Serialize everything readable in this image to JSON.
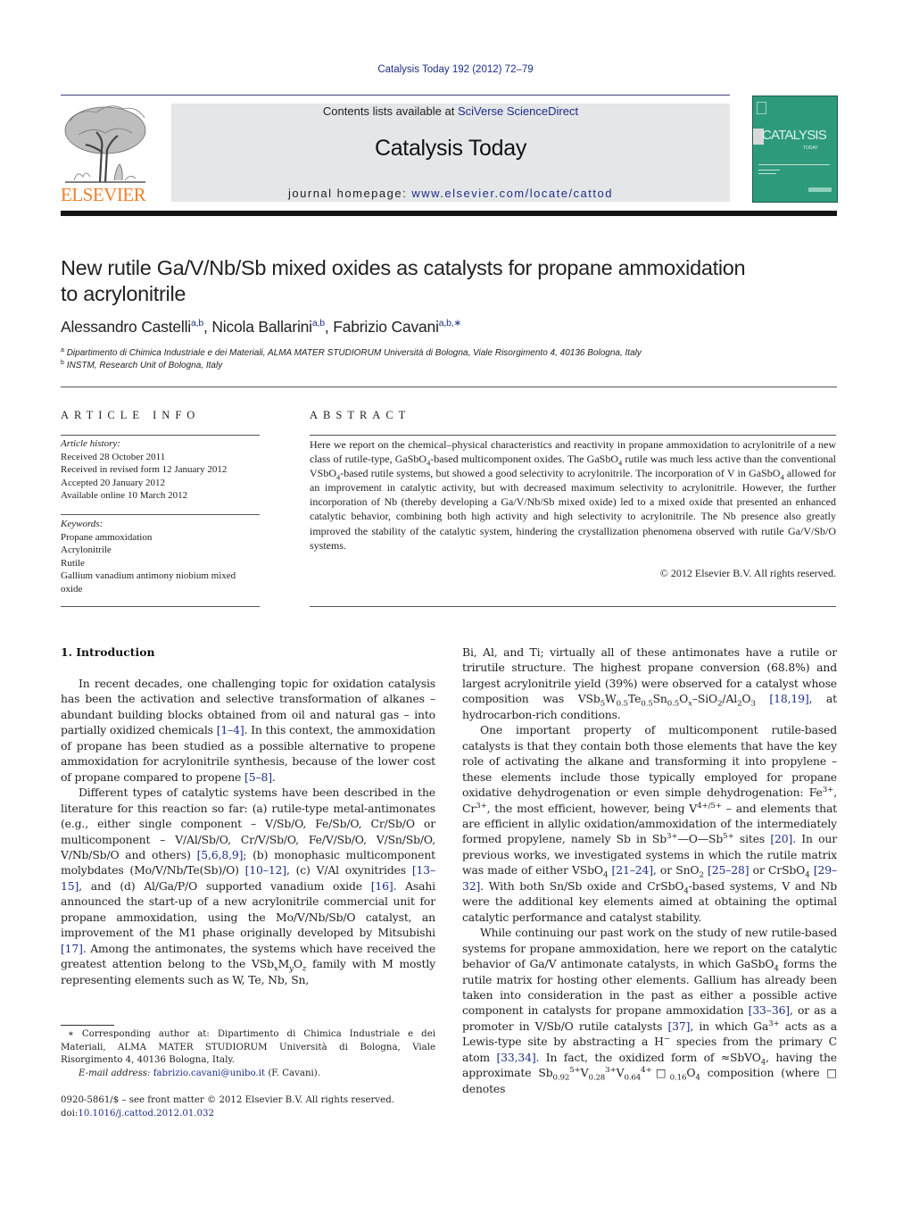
{
  "header": {
    "citation": "Catalysis Today 192 (2012) 72–79",
    "contents_prefix": "Contents lists available at ",
    "contents_link": "SciVerse ScienceDirect",
    "journal_title": "Catalysis Today",
    "homepage_prefix": "journal homepage: ",
    "homepage_link": "www.elsevier.com/locate/cattod",
    "publisher_logo_text": "ELSEVIER",
    "cover_title": "CATALYSIS",
    "cover_subtitle": "TODAY",
    "colors": {
      "link": "#1d2f87",
      "elsevier_orange": "#f07f2a",
      "cover_green": "#2e9a7c",
      "band_gray": "#e5e6e8"
    }
  },
  "article": {
    "title_line1": "New rutile Ga/V/Nb/Sb mixed oxides as catalysts for propane ammoxidation",
    "title_line2": "to acrylonitrile",
    "authors": [
      {
        "name": "Alessandro Castelli",
        "sup": "a,b"
      },
      {
        "name": "Nicola Ballarini",
        "sup": "a,b"
      },
      {
        "name": "Fabrizio Cavani",
        "sup": "a,b,∗"
      }
    ],
    "author_separator": ", ",
    "affiliations": [
      {
        "mark": "a",
        "text": "Dipartimento di Chimica Industriale e dei Materiali, ALMA MATER STUDIORUM Università di Bologna, Viale Risorgimento 4, 40136 Bologna, Italy"
      },
      {
        "mark": "b",
        "text": "INSTM, Research Unit of Bologna, Italy"
      }
    ]
  },
  "article_info": {
    "heading": "ARTICLE INFO",
    "history_label": "Article history:",
    "history": [
      "Received 28 October 2011",
      "Received in revised form 12 January 2012",
      "Accepted 20 January 2012",
      "Available online 10 March 2012"
    ],
    "keywords_label": "Keywords:",
    "keywords": [
      "Propane ammoxidation",
      "Acrylonitrile",
      "Rutile",
      "Gallium vanadium antimony niobium mixed oxide"
    ]
  },
  "abstract": {
    "heading": "ABSTRACT",
    "t1": "Here we report on the chemical–physical characteristics and reactivity in propane ammoxidation to acrylonitrile of a new class of rutile-type, GaSbO",
    "t2": "-based multicomponent oxides. The GaSbO",
    "t3": " rutile was much less active than the conventional VSbO",
    "t4": "-based rutile systems, but showed a good selectivity to acrylonitrile. The incorporation of V in GaSbO",
    "t5": " allowed for an improvement in catalytic activity, but with decreased maximum selectivity to acrylonitrile. However, the further incorporation of Nb (thereby developing a Ga/V/Nb/Sb mixed oxide) led to a mixed oxide that presented an enhanced catalytic behavior, combining both high activity and high selectivity to acrylonitrile. The Nb presence also greatly improved the stability of the catalytic system, hindering the crystallization phenomena observed with rutile Ga/V/Sb/O systems.",
    "sub4": "4",
    "copyright": "© 2012 Elsevier B.V. All rights reserved."
  },
  "intro": {
    "heading": "1.  Introduction",
    "p1a": "In recent decades, one challenging topic for oxidation catalysis has been the activation and selective transformation of alkanes – abundant building blocks obtained from oil and natural gas – into partially oxidized chemicals ",
    "ref1": "[1–4]",
    "p1b": ". In this context, the ammoxidation of propane has been studied as a possible alternative to propene ammoxidation for acrylonitrile synthesis, because of the lower cost of propane compared to propene ",
    "ref2": "[5–8]",
    "p1c": ".",
    "p2a": "Different types of catalytic systems have been described in the literature for this reaction so far: (a) rutile-type metal-antimonates (e.g., either single component – V/Sb/O, Fe/Sb/O, Cr/Sb/O or multicomponent – V/Al/Sb/O, Cr/V/Sb/O, Fe/V/Sb/O, V/Sn/Sb/O, V/Nb/Sb/O and others) ",
    "ref3": "[5,6,8,9]",
    "p2b": "; (b) monophasic multicomponent molybdates (Mo/V/Nb/Te(Sb)/O) ",
    "ref4": "[10–12]",
    "p2c": ", (c) V/Al oxynitrides ",
    "ref5": "[13–15]",
    "p2d": ", and (d) Al/Ga/P/O supported vanadium oxide ",
    "ref6": "[16]",
    "p2e": ". Asahi announced the start-up of a new acrylonitrile commercial unit for propane ammoxidation, using the Mo/V/Nb/Sb/O catalyst, an improvement of the M1 phase originally developed by Mitsubishi ",
    "ref7": "[17]",
    "p2f": ". Among the antimonates, the systems which have received the greatest attention belong to the VSb",
    "p2g": " family with M mostly representing elements such as W, Te, Nb, Sn,",
    "c2_p1a": "Bi, Al, and Ti; virtually all of these antimonates have a rutile or trirutile structure. The highest propane conversion (68.8%) and largest acrylonitrile yield (39%) were observed for a catalyst whose composition was VSb",
    "ref8": "[18,19]",
    "c2_p1b": ", at hydrocarbon-rich conditions.",
    "c2_p2a": "One important property of multicomponent rutile-based catalysts is that they contain both those elements that have the key role of activating the alkane and transforming it into propylene – these elements include those typically employed for propane oxidative dehydrogenation or even simple dehydrogenation: Fe",
    "c2_p2b": ", the most efficient, however, being V",
    "c2_p2c": " – and elements that are efficient in allylic oxidation/ammoxidation of the intermediately formed propylene, namely Sb in Sb",
    "ref9": "[20]",
    "c2_p2d": ". In our previous works, we investigated systems in which the rutile matrix was made of either VSbO",
    "ref10": "[21–24]",
    "ref11": "[25–28]",
    "ref12": "[29–32]",
    "c2_p2e": ". With both Sn/Sb oxide and CrSbO",
    "c2_p2f": "-based systems, V and Nb were the additional key elements aimed at obtaining the optimal catalytic performance and catalyst stability.",
    "c2_p3a": "While continuing our past work on the study of new rutile-based systems for propane ammoxidation, here we report on the catalytic behavior of Ga/V antimonate catalysts, in which GaSbO",
    "c2_p3b": " forms the rutile matrix for hosting other elements. Gallium has already been taken into consideration in the past as either a possible active component in catalysts for propane ammoxidation ",
    "ref13": "[33–36]",
    "c2_p3c": ", or as a promoter in V/Sb/O rutile catalysts ",
    "ref14": "[37]",
    "c2_p3d": ", in which Ga",
    "c2_p3e": " acts as a Lewis-type site by abstracting a H",
    "c2_p3f": " species from the primary C atom ",
    "ref15": "[33,34]",
    "c2_p3g": ". In fact, the oxidized form of ≈SbVO",
    "c2_p3h": ", having the approximate Sb",
    "c2_p3i": " composition (where □ denotes"
  },
  "footnote": {
    "corresponding": "∗ Corresponding author at: Dipartimento di Chimica Industriale e dei Materiali, ALMA MATER STUDIORUM Università di Bologna, Viale Risorgimento 4, 40136 Bologna, Italy.",
    "email_label": "E-mail address: ",
    "email": "fabrizio.cavani@unibo.it",
    "email_suffix": " (F. Cavani).",
    "issn": "0920-5861/$ – see front matter © 2012 Elsevier B.V. All rights reserved.",
    "doi_prefix": "doi:",
    "doi": "10.1016/j.cattod.2012.01.032"
  }
}
